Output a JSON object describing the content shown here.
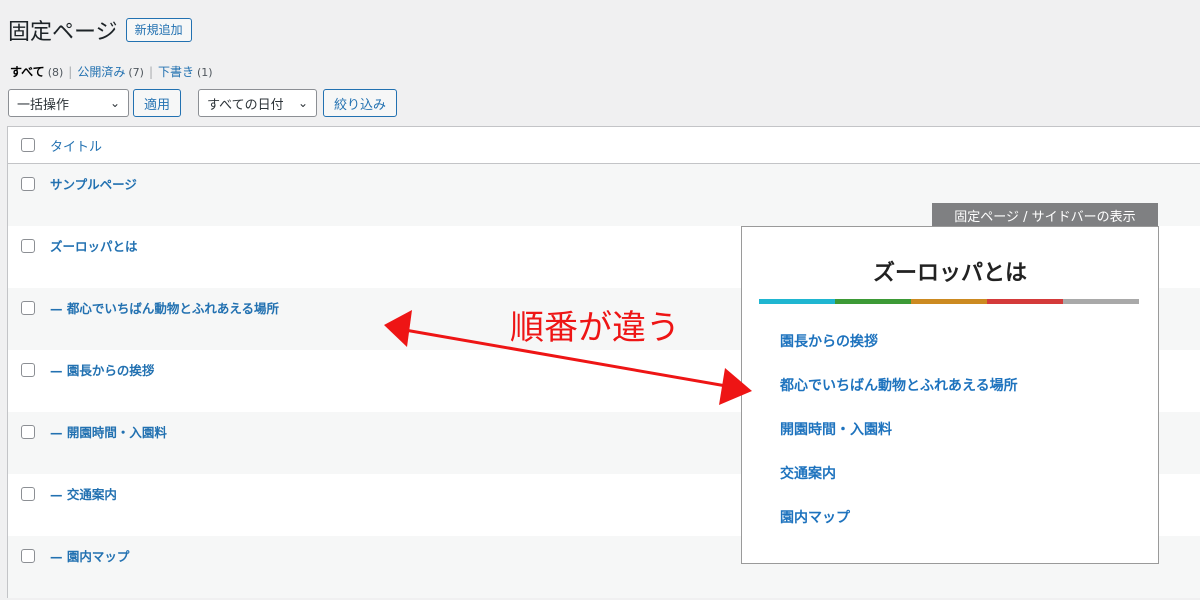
{
  "header": {
    "title": "固定ページ",
    "add_new_label": "新規追加"
  },
  "filters": [
    {
      "label": "すべて",
      "count": "(8)",
      "current": true
    },
    {
      "label": "公開済み",
      "count": "(7)",
      "current": false
    },
    {
      "label": "下書き",
      "count": "(1)",
      "current": false
    }
  ],
  "tablenav": {
    "bulk_action": "一括操作",
    "apply_label": "適用",
    "date_filter": "すべての日付",
    "filter_label": "絞り込み"
  },
  "table": {
    "column_title": "タイトル",
    "rows": [
      "サンプルページ",
      "ズーロッパとは",
      "— 都心でいちばん動物とふれあえる場所",
      "— 園長からの挨拶",
      "— 開園時間・入園料",
      "— 交通案内",
      "— 園内マップ"
    ]
  },
  "widget": {
    "label": "固定ページ / サイドバーの表示",
    "title": "ズーロッパとは",
    "stripe_colors": [
      "#1fb6d1",
      "#3d9a36",
      "#cc8a21",
      "#d43a3a",
      "#a9a9a9"
    ],
    "items": [
      "園長からの挨拶",
      "都心でいちばん動物とふれあえる場所",
      "開園時間・入園料",
      "交通案内",
      "園内マップ"
    ]
  },
  "annotation": {
    "text": "順番が違う",
    "color": "#ee1515"
  }
}
